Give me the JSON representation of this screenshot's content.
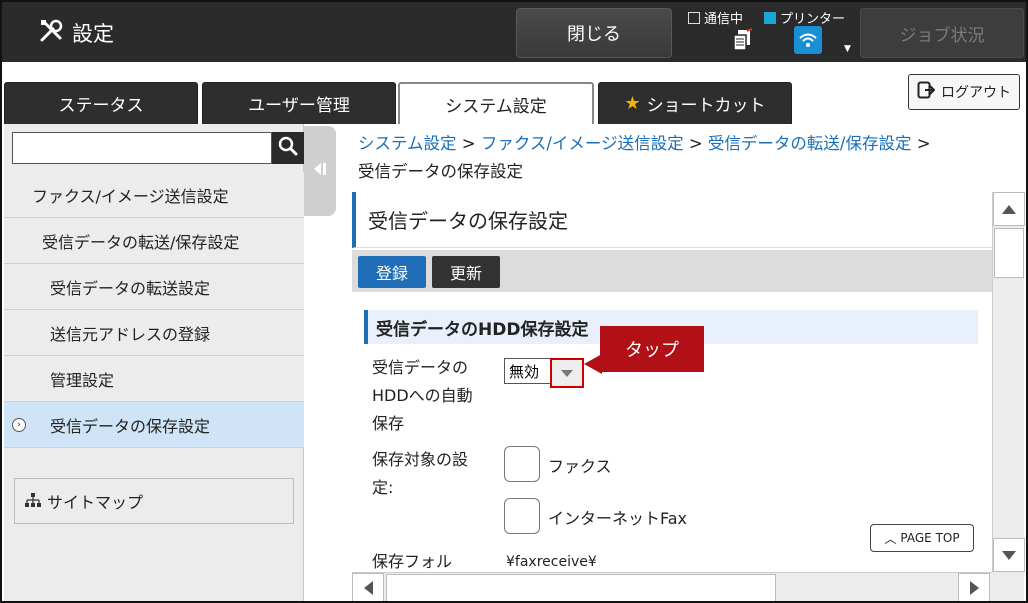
{
  "header": {
    "title": "設定",
    "close_label": "閉じる",
    "status_comm": "通信中",
    "status_printer": "プリンター",
    "job_status_label": "ジョブ状況"
  },
  "tabs": [
    {
      "label": "ステータス"
    },
    {
      "label": "ユーザー管理"
    },
    {
      "label": "システム設定"
    },
    {
      "label": "ショートカット"
    }
  ],
  "logout_label": "ログアウト",
  "search": {
    "value": "",
    "placeholder": ""
  },
  "sidebar": {
    "items": [
      {
        "label": "ファクス/イメージ送信設定"
      },
      {
        "label": "受信データの転送/保存設定"
      },
      {
        "label": "受信データの転送設定"
      },
      {
        "label": "送信元アドレスの登録"
      },
      {
        "label": "管理設定"
      },
      {
        "label": "受信データの保存設定"
      }
    ],
    "sitemap_label": "サイトマップ"
  },
  "breadcrumb": {
    "links": [
      "システム設定",
      "ファクス/イメージ送信設定",
      "受信データの転送/保存設定"
    ],
    "separator": ">",
    "current": "受信データの保存設定"
  },
  "main": {
    "page_title": "受信データの保存設定",
    "register_label": "登録",
    "update_label": "更新",
    "section_title": "受信データのHDD保存設定",
    "auto_save_label_1": "受信データの",
    "auto_save_label_2": "HDDへの自動",
    "auto_save_label_3": "保存",
    "auto_save_value": "無効",
    "callout": "タップ",
    "target_label_1": "保存対象の設",
    "target_label_2": "定:",
    "fax_label": "ファクス",
    "ifax_label": "インターネットFax",
    "folder_label": "保存フォル",
    "folder_value": "¥faxreceive¥",
    "page_top_label": "PAGE TOP"
  }
}
